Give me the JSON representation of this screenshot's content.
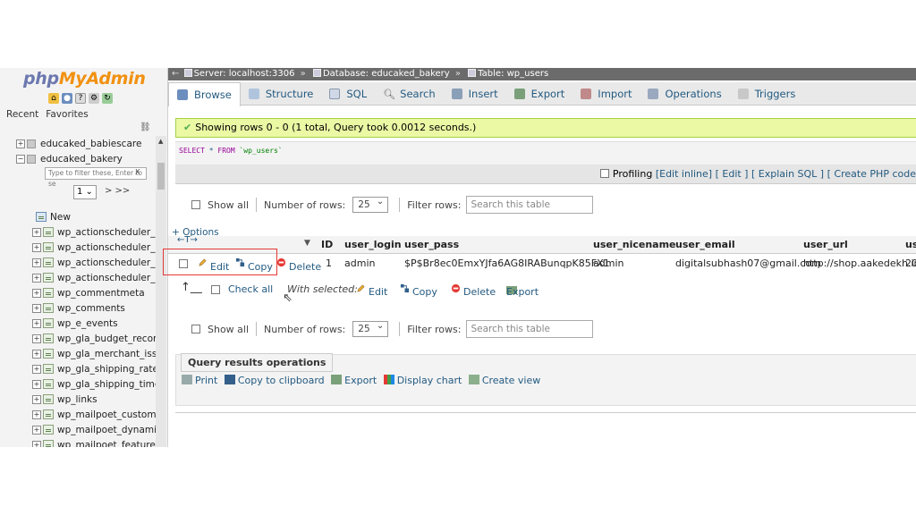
{
  "logo": {
    "php": "php",
    "my": "MyAdmin"
  },
  "nav_tabs": [
    "Recent",
    "Favorites"
  ],
  "tree": {
    "databases": [
      {
        "name": "educaked_babiescare",
        "exp": "+"
      },
      {
        "name": "educaked_bakery",
        "exp": "−"
      }
    ],
    "filter_placeholder": "Type to filter these, Enter to se",
    "filter_clear": "X",
    "page_value": "1",
    "page_next": "> >>",
    "new_label": "New",
    "tables": [
      "wp_actionscheduler_ac",
      "wp_actionscheduler_cl",
      "wp_actionscheduler_gr",
      "wp_actionscheduler_lo",
      "wp_commentmeta",
      "wp_comments",
      "wp_e_events",
      "wp_gla_budget_recom",
      "wp_gla_merchant_issu",
      "wp_gla_shipping_rates",
      "wp_gla_shipping_times",
      "wp_links",
      "wp_mailpoet_custom_f",
      "wp_mailpoet_dynamic_",
      "wp_mailpoet_feature_f"
    ]
  },
  "breadcrumb": {
    "server": "Server: localhost:3306",
    "database": "Database: educaked_bakery",
    "table": "Table: wp_users"
  },
  "tabs": [
    "Browse",
    "Structure",
    "SQL",
    "Search",
    "Insert",
    "Export",
    "Import",
    "Operations",
    "Triggers"
  ],
  "success_msg": "Showing rows 0 - 0 (1 total, Query took 0.0012 seconds.)",
  "sql": {
    "kw1": "SELECT",
    "star": "*",
    "kw2": "FROM",
    "table": "`wp_users`"
  },
  "profiling": {
    "label": "Profiling",
    "edit_inline": "[Edit inline]",
    "edit": "[ Edit ]",
    "explain": "[ Explain SQL ]",
    "create_php": "[ Create PHP code"
  },
  "nav": {
    "show_all": "Show all",
    "rows_label": "Number of rows:",
    "rows_value": "25",
    "filter_label": "Filter rows:",
    "filter_placeholder": "Search this table"
  },
  "options_link": "+ Options",
  "columns": [
    "ID",
    "user_login",
    "user_pass",
    "user_nicename",
    "user_email",
    "user_url",
    "us"
  ],
  "row": {
    "edit": "Edit",
    "copy": "Copy",
    "delete": "Delete",
    "id": "1",
    "user_login": "admin",
    "user_pass": "$P$Br8ec0EmxYJfa6AG8IRABunqpK85FX1",
    "user_nicename": "admin",
    "user_email": "digitalsubhash07@gmail.com",
    "user_url": "http://shop.aakedekh.in",
    "user_registered": "20"
  },
  "with_selected": {
    "check_all": "Check all",
    "label": "With selected:",
    "edit": "Edit",
    "copy": "Copy",
    "delete": "Delete",
    "export": "Export"
  },
  "qro": {
    "title": "Query results operations",
    "print": "Print",
    "copy_clipboard": "Copy to clipboard",
    "export": "Export",
    "display_chart": "Display chart",
    "create_view": "Create view"
  },
  "colors": {
    "link": "#235a81",
    "success_bg": "#ebf8a4",
    "highlight": "#e53935"
  }
}
